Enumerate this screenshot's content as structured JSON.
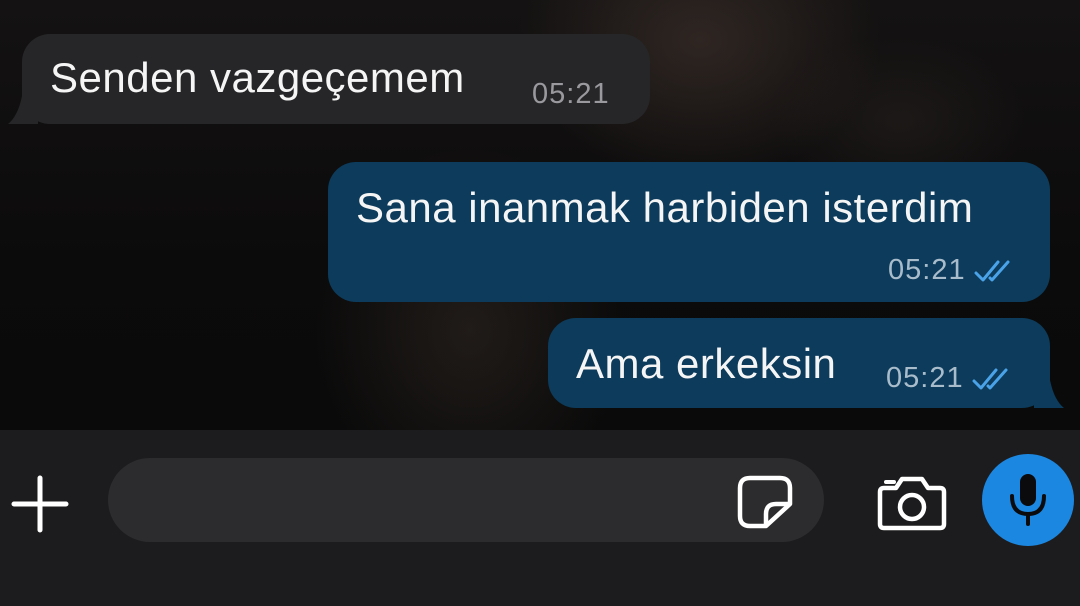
{
  "messages": [
    {
      "direction": "incoming",
      "text": "Senden vazgeçemem",
      "time": "05:21"
    },
    {
      "direction": "outgoing",
      "text": "Sana inanmak harbiden isterdim",
      "time": "05:21",
      "status": "read"
    },
    {
      "direction": "outgoing",
      "text": "Ama erkeksin",
      "time": "05:21",
      "status": "read"
    }
  ],
  "composer": {
    "value": "",
    "placeholder": ""
  },
  "icons": {
    "attach": "plus-icon",
    "sticker": "sticker-icon",
    "camera": "camera-icon",
    "voice": "microphone-icon",
    "read_status": "double-check-icon"
  },
  "colors": {
    "incoming_bubble": "#262628",
    "outgoing_bubble": "#0c3b5b",
    "read_check": "#4aa3e8",
    "mic_button": "#1c87e0"
  }
}
